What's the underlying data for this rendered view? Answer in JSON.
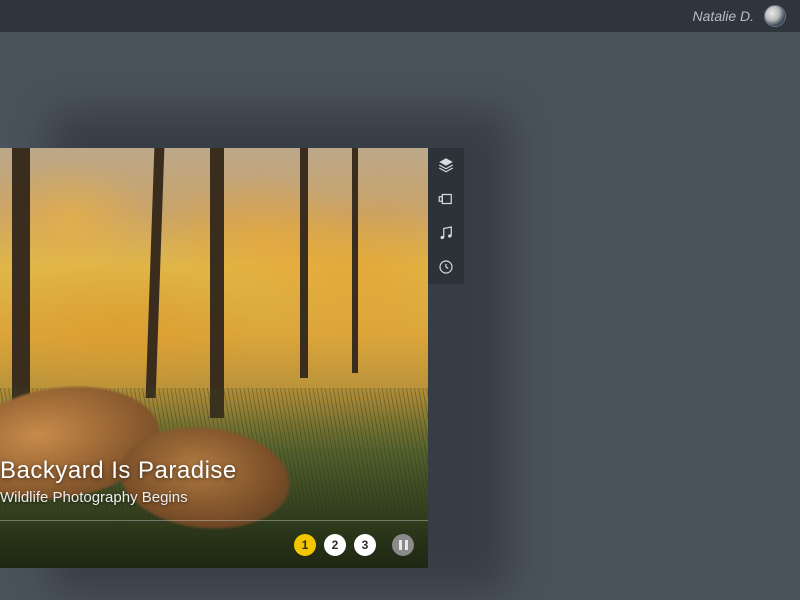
{
  "header": {
    "username": "Natalie D."
  },
  "slide": {
    "title": "Backyard Is Paradise",
    "subtitle": "Wildlife Photography Begins",
    "pages": [
      "1",
      "2",
      "3"
    ],
    "active_page": 1
  },
  "toolbar": {
    "items": [
      {
        "name": "layers-icon"
      },
      {
        "name": "frame-icon"
      },
      {
        "name": "music-icon"
      },
      {
        "name": "clock-icon"
      }
    ]
  }
}
